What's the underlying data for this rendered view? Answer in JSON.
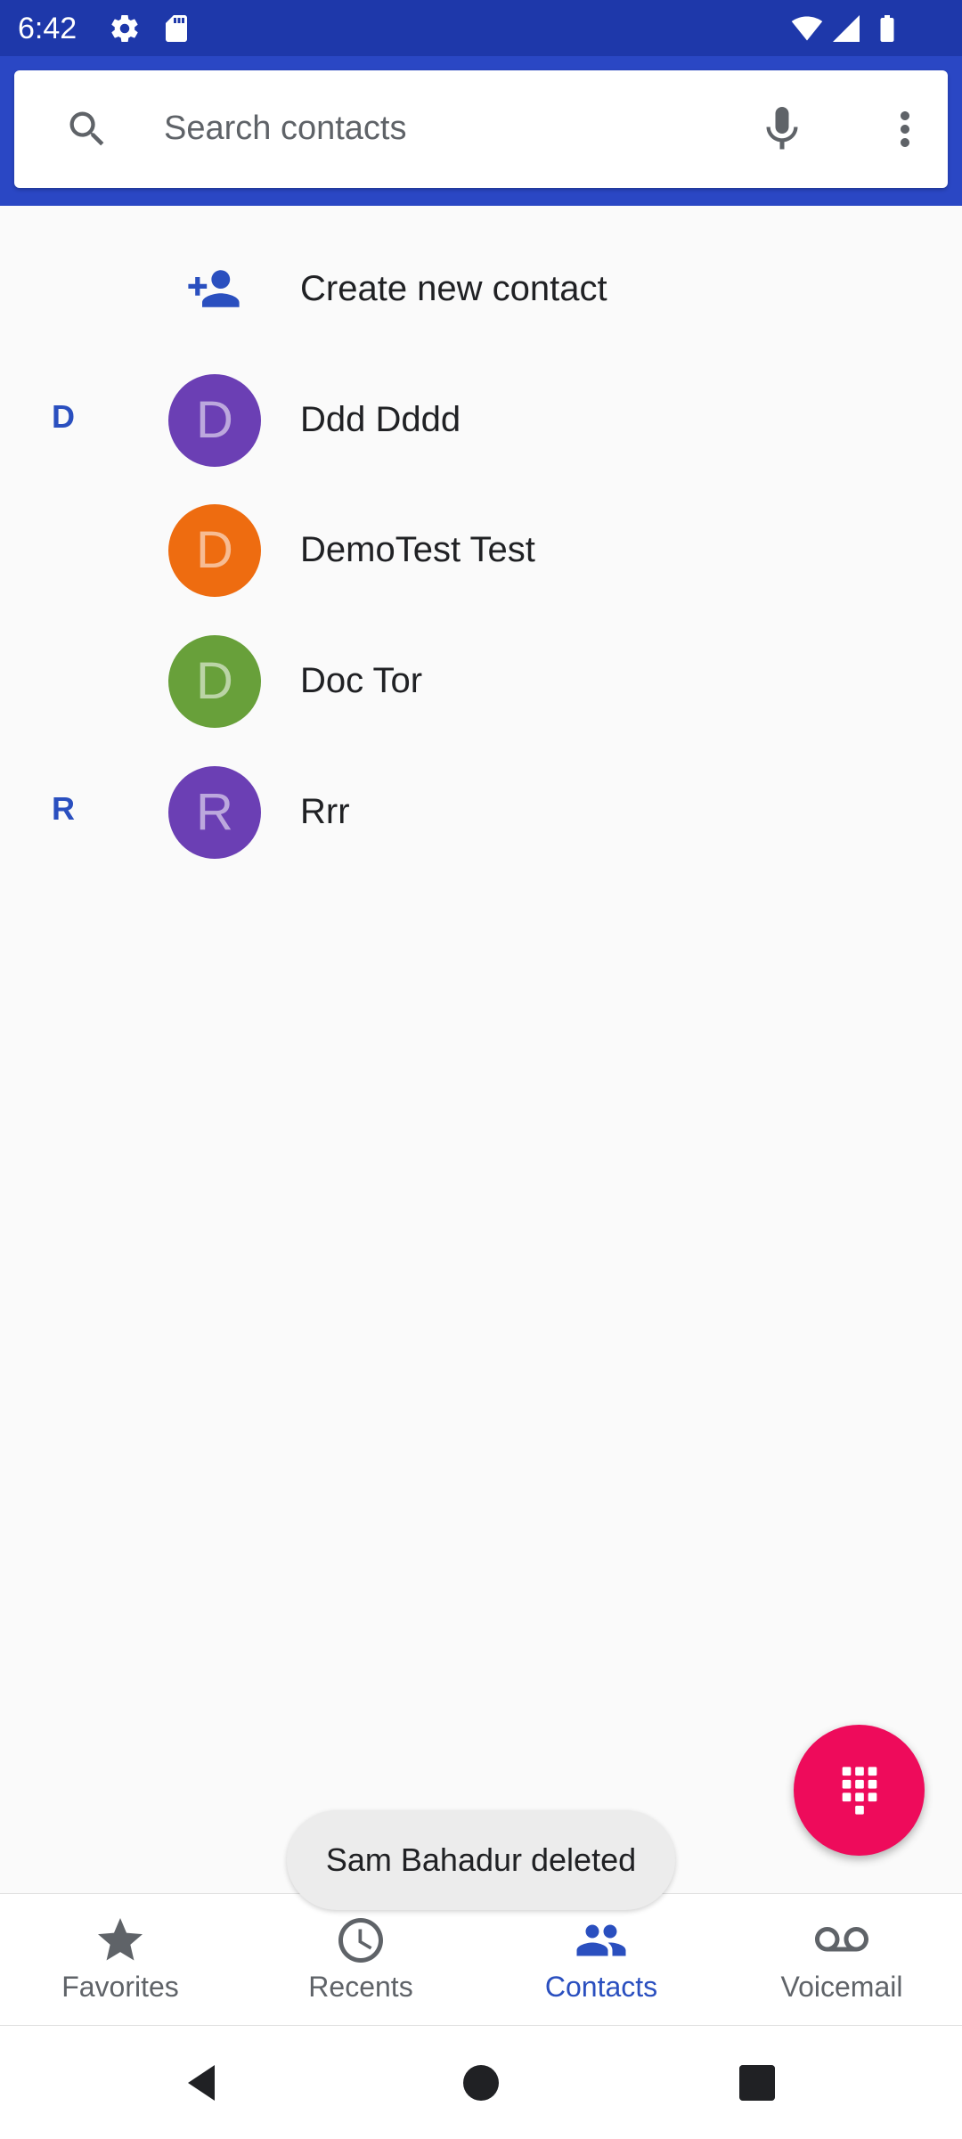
{
  "status_bar": {
    "time": "6:42",
    "icons": [
      "gear-icon",
      "sd-card-icon",
      "wifi-icon",
      "signal-icon",
      "battery-icon"
    ]
  },
  "search": {
    "placeholder": "Search contacts",
    "value": "",
    "icons": [
      "search-icon",
      "mic-icon",
      "more-vert-icon"
    ]
  },
  "create_contact": {
    "label": "Create new contact",
    "icon": "person-add-icon"
  },
  "contacts": [
    {
      "section": "D",
      "initial": "D",
      "name": "Ddd Dddd",
      "color": "#6b3fb4"
    },
    {
      "section": "",
      "initial": "D",
      "name": "DemoTest Test",
      "color": "#ee6c10"
    },
    {
      "section": "",
      "initial": "D",
      "name": "Doc Tor",
      "color": "#68a03a"
    },
    {
      "section": "R",
      "initial": "R",
      "name": "Rrr",
      "color": "#6b3fb4"
    }
  ],
  "fab": {
    "icon": "dialpad-icon",
    "color": "#ee0b5b"
  },
  "toast": {
    "message": "Sam Bahadur deleted"
  },
  "bottom_nav": {
    "active": "Contacts",
    "items": [
      {
        "label": "Favorites",
        "icon": "star-icon"
      },
      {
        "label": "Recents",
        "icon": "clock-icon"
      },
      {
        "label": "Contacts",
        "icon": "people-icon"
      },
      {
        "label": "Voicemail",
        "icon": "voicemail-icon"
      }
    ]
  },
  "system_nav": {
    "buttons": [
      "back-icon",
      "home-icon",
      "recents-icon"
    ]
  },
  "colors": {
    "header": "#2a47c4",
    "status_bar": "#1e38aa",
    "accent": "#2a4fbf"
  }
}
